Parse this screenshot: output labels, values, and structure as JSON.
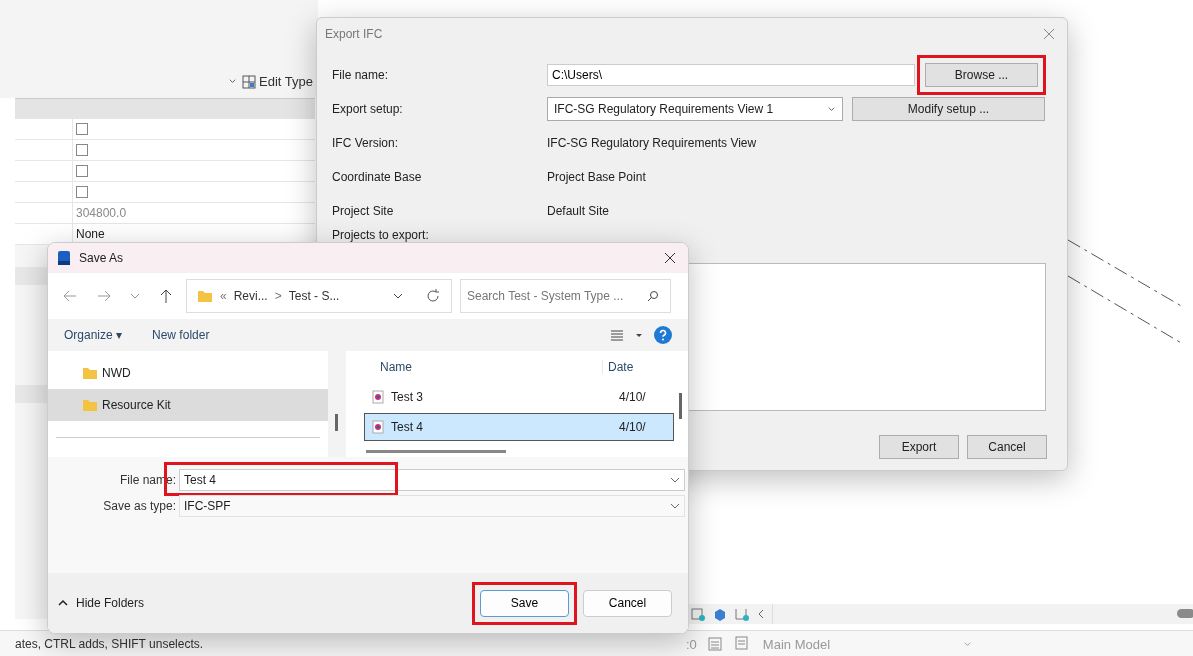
{
  "revit": {
    "edit_type": "Edit Type",
    "properties": [
      {
        "kind": "checkbox",
        "checked": false
      },
      {
        "kind": "checkbox",
        "checked": false
      },
      {
        "kind": "checkbox",
        "checked": false
      },
      {
        "kind": "checkbox",
        "checked": false
      },
      {
        "kind": "text",
        "value": "304800.0",
        "disabled": true
      },
      {
        "kind": "text",
        "value": "None",
        "disabled": false
      }
    ],
    "status_text": "ates, CTRL adds, SHIFT unselects.",
    "selection_count": ":0",
    "model": "Main Model"
  },
  "export_dialog": {
    "title": "Export IFC",
    "rows": [
      {
        "label": "File name:",
        "kind": "input",
        "value": "C:\\Users\\",
        "button": {
          "label": "Browse ...",
          "highlighted": true
        }
      },
      {
        "label": "Export setup:",
        "kind": "select",
        "value": "IFC-SG Regulatory Requirements View 1",
        "button": {
          "label": "Modify setup ...",
          "highlighted": false
        }
      },
      {
        "label": "IFC Version:",
        "kind": "text",
        "value": "IFC-SG Regulatory Requirements View"
      },
      {
        "label": "Coordinate Base",
        "kind": "text",
        "value": "Project Base Point"
      },
      {
        "label": "Project Site",
        "kind": "text",
        "value": "Default Site"
      },
      {
        "label": "Projects to export:",
        "kind": "list"
      }
    ],
    "buttons": [
      "Export",
      "Cancel"
    ]
  },
  "save_dialog": {
    "title": "Save As",
    "path": [
      "«",
      "Revi...",
      ">",
      "Test - S..."
    ],
    "search": {
      "placeholder": "Search Test - System Type ..."
    },
    "toolbar": {
      "organize": "Organize ▾",
      "new_folder": "New folder"
    },
    "folders": [
      {
        "name": "NWD",
        "selected": false
      },
      {
        "name": "Resource Kit",
        "selected": true
      }
    ],
    "columns": [
      "Name",
      "Date"
    ],
    "files": [
      {
        "name": "Test 3",
        "date": "4/10/",
        "selected": false
      },
      {
        "name": "Test 4",
        "date": "4/10/",
        "selected": true
      }
    ],
    "file_name": {
      "label": "File name:",
      "value": "Test 4",
      "highlighted": true
    },
    "save_type": {
      "label": "Save as type:",
      "value": "IFC-SPF"
    },
    "hide_folders": "Hide Folders",
    "buttons": [
      {
        "label": "Save",
        "highlighted": true
      },
      {
        "label": "Cancel",
        "highlighted": false
      }
    ]
  }
}
